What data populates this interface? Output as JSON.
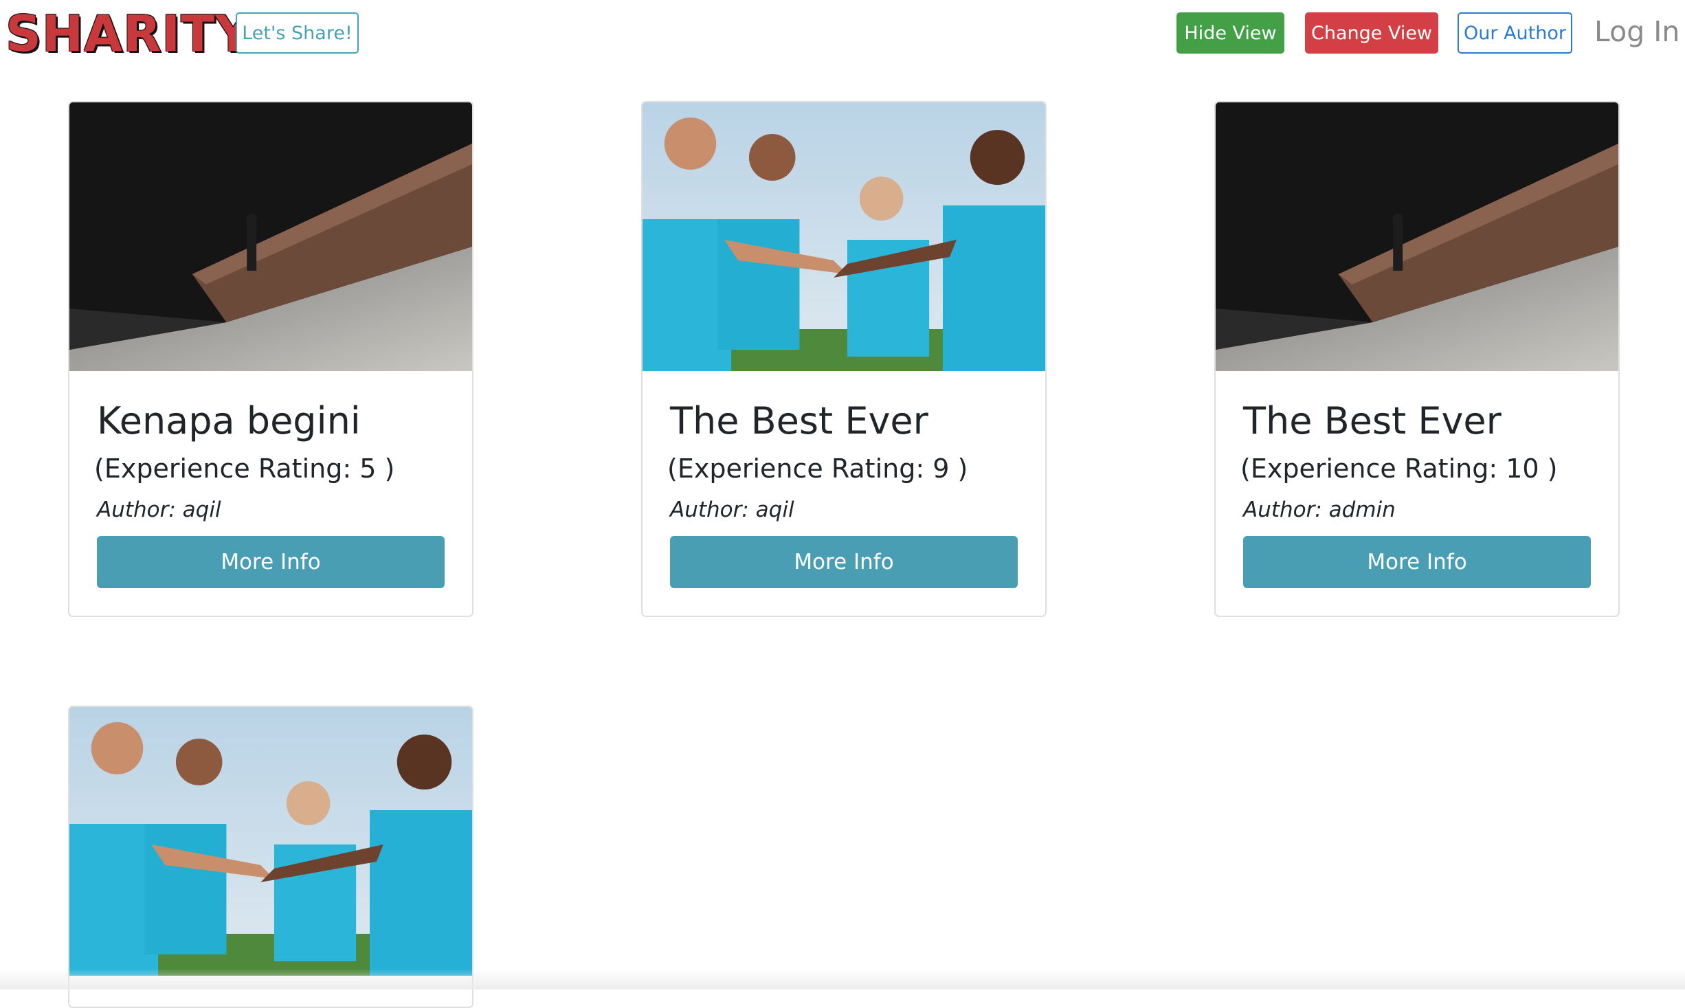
{
  "navbar": {
    "logo_text": "SHARITY",
    "share_label": "Let's Share!",
    "hide_view_label": "Hide View",
    "change_view_label": "Change View",
    "our_author_label": "Our Author",
    "login_label": "Log In"
  },
  "cards": [
    {
      "image": "street-shadow-photo",
      "title": "Kenapa begini",
      "rating": "(Experience Rating: 5 )",
      "author": "Author: aqil",
      "button_label": "More Info"
    },
    {
      "image": "volunteers-photo",
      "title": "The Best Ever",
      "rating": "(Experience Rating: 9 )",
      "author": "Author: aqil",
      "button_label": "More Info"
    },
    {
      "image": "street-shadow-photo",
      "title": "The Best Ever",
      "rating": "(Experience Rating: 10 )",
      "author": "Author: admin",
      "button_label": "More Info"
    },
    {
      "image": "volunteers-photo"
    }
  ],
  "colors": {
    "share_outline": "#47a2b5",
    "hide_view_bg": "#43a047",
    "change_view_bg": "#d33f45",
    "our_author_outline": "#2b7bd1",
    "more_info_bg": "#4a9eb4",
    "logo_red": "#c9383b"
  }
}
